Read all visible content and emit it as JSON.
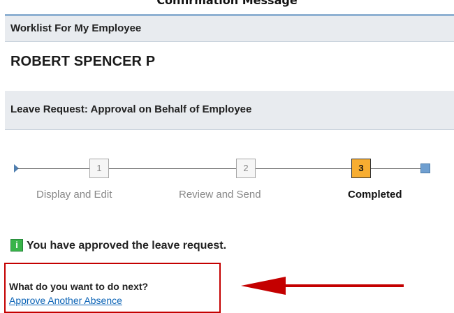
{
  "top_title": "Confirmation Message",
  "worklist": {
    "title": "Worklist For My Employee",
    "employee_name": "ROBERT SPENCER P"
  },
  "leave_request": {
    "title": "Leave Request: Approval on Behalf of Employee"
  },
  "stepper": {
    "steps": [
      {
        "number": "1",
        "label": "Display and Edit",
        "state": "inactive"
      },
      {
        "number": "2",
        "label": "Review and Send",
        "state": "inactive"
      },
      {
        "number": "3",
        "label": "Completed",
        "state": "active"
      }
    ],
    "active_step": 3
  },
  "message": {
    "icon_label": "i",
    "text": "You have approved the leave request."
  },
  "next_actions": {
    "title": "What do you want to do next?",
    "link_label": "Approve Another Absence"
  },
  "colors": {
    "section_background": "#e8ebef",
    "section_border": "#8fb1d2",
    "active_step": "#f7ad31",
    "info_icon": "#39b449",
    "callout_red": "#c40000",
    "link_blue": "#0b63b6"
  },
  "icons": {
    "start_marker": "triangle-right",
    "end_marker": "square",
    "message": "info-icon",
    "callout": "red-arrow-left"
  }
}
